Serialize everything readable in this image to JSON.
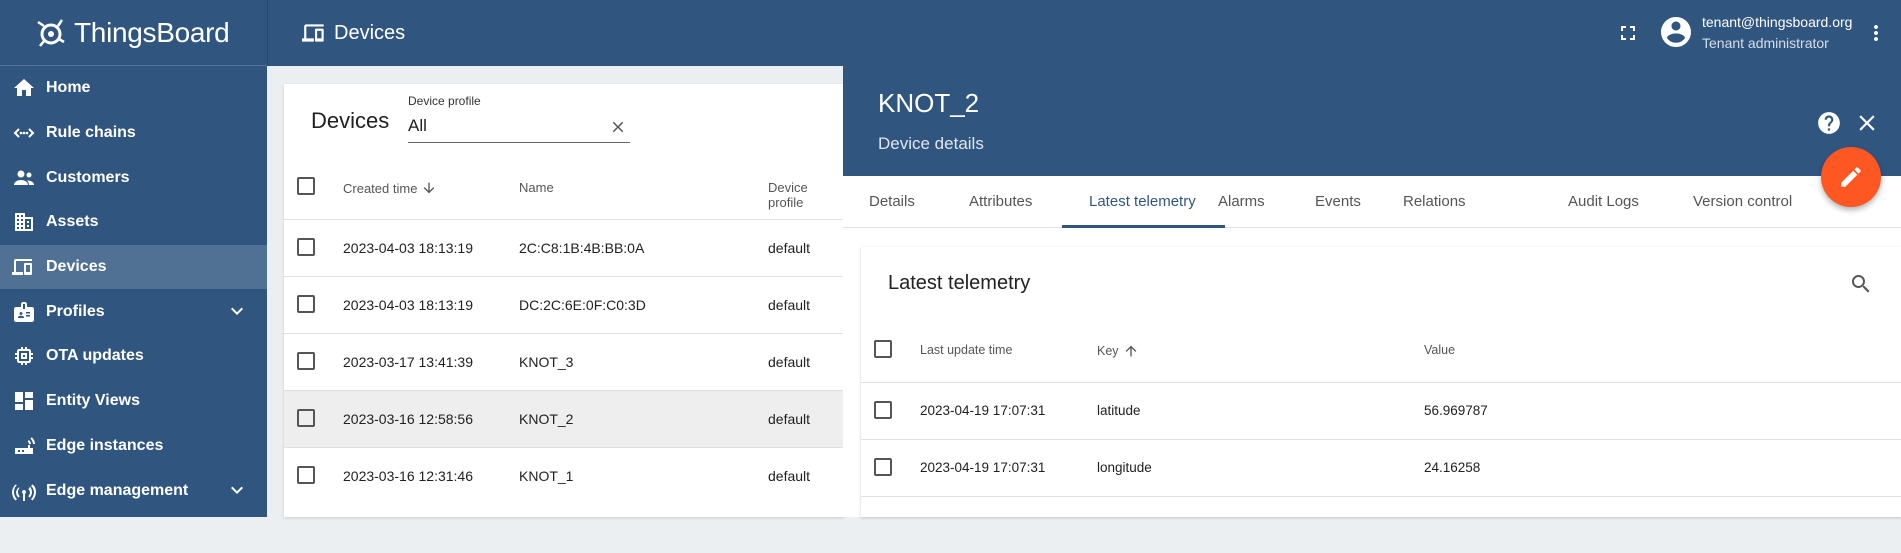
{
  "app": {
    "name": "ThingsBoard"
  },
  "sidebar": {
    "items": [
      {
        "label": "Home",
        "icon": "home-icon"
      },
      {
        "label": "Rule chains",
        "icon": "rule-chain-icon"
      },
      {
        "label": "Customers",
        "icon": "customers-icon"
      },
      {
        "label": "Assets",
        "icon": "assets-icon"
      },
      {
        "label": "Devices",
        "icon": "devices-icon",
        "active": true
      },
      {
        "label": "Profiles",
        "icon": "profiles-icon",
        "expandable": true
      },
      {
        "label": "OTA updates",
        "icon": "ota-icon"
      },
      {
        "label": "Entity Views",
        "icon": "entity-views-icon"
      },
      {
        "label": "Edge instances",
        "icon": "edge-instances-icon"
      },
      {
        "label": "Edge management",
        "icon": "edge-management-icon",
        "expandable": true
      }
    ]
  },
  "topbar": {
    "title": "Devices",
    "user_email": "tenant@thingsboard.org",
    "user_role": "Tenant administrator"
  },
  "devices": {
    "title": "Devices",
    "filter_label": "Device profile",
    "filter_value": "All",
    "columns": [
      "Created time",
      "Name",
      "Device profile"
    ],
    "rows": [
      {
        "created": "2023-04-03 18:13:19",
        "name": "2C:C8:1B:4B:BB:0A",
        "profile": "default"
      },
      {
        "created": "2023-04-03 18:13:19",
        "name": "DC:2C:6E:0F:C0:3D",
        "profile": "default"
      },
      {
        "created": "2023-03-17 13:41:39",
        "name": "KNOT_3",
        "profile": "default"
      },
      {
        "created": "2023-03-16 12:58:56",
        "name": "KNOT_2",
        "profile": "default",
        "selected": true
      },
      {
        "created": "2023-03-16 12:31:46",
        "name": "KNOT_1",
        "profile": "default"
      }
    ]
  },
  "details": {
    "name": "KNOT_2",
    "subtitle": "Device details",
    "tabs": [
      "Details",
      "Attributes",
      "Latest telemetry",
      "Alarms",
      "Events",
      "Relations",
      "Audit Logs",
      "Version control"
    ],
    "active_tab": "Latest telemetry"
  },
  "telemetry": {
    "title": "Latest telemetry",
    "columns": [
      "Last update time",
      "Key",
      "Value"
    ],
    "rows": [
      {
        "time": "2023-04-19 17:07:31",
        "key": "latitude",
        "value": "56.969787"
      },
      {
        "time": "2023-04-19 17:07:31",
        "key": "longitude",
        "value": "24.16258"
      }
    ]
  },
  "colors": {
    "primary": "#305680",
    "accent": "#ff5722"
  }
}
